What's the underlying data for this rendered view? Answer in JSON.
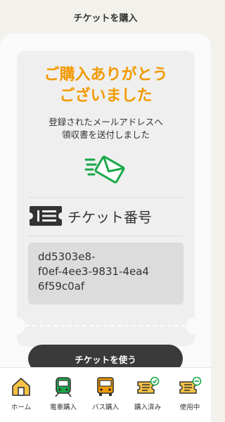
{
  "header": {
    "title": "チケットを購入"
  },
  "card": {
    "title_lines": [
      "ご購入ありがとう",
      "ございました"
    ],
    "subtitle_lines": [
      "登録されたメールアドレスへ",
      "領収書を送付しました"
    ],
    "ticket_label": "チケット番号",
    "ticket_code_lines": [
      "dd5303e8-",
      "f0ef-4ee3-9831-4ea4",
      "6f59c0af"
    ]
  },
  "actions": {
    "use_ticket_label": "チケットを使う"
  },
  "tabbar": {
    "items": [
      {
        "label": "ホーム",
        "icon": "home-icon"
      },
      {
        "label": "電車購入",
        "icon": "train-icon"
      },
      {
        "label": "バス購入",
        "icon": "bus-icon"
      },
      {
        "label": "購入済み",
        "icon": "ticket-check-icon"
      },
      {
        "label": "使用中",
        "icon": "ticket-minus-icon"
      }
    ]
  },
  "colors": {
    "accent": "#f29a00",
    "mail_green": "#1aa84a",
    "dark": "#3a3a3a"
  }
}
